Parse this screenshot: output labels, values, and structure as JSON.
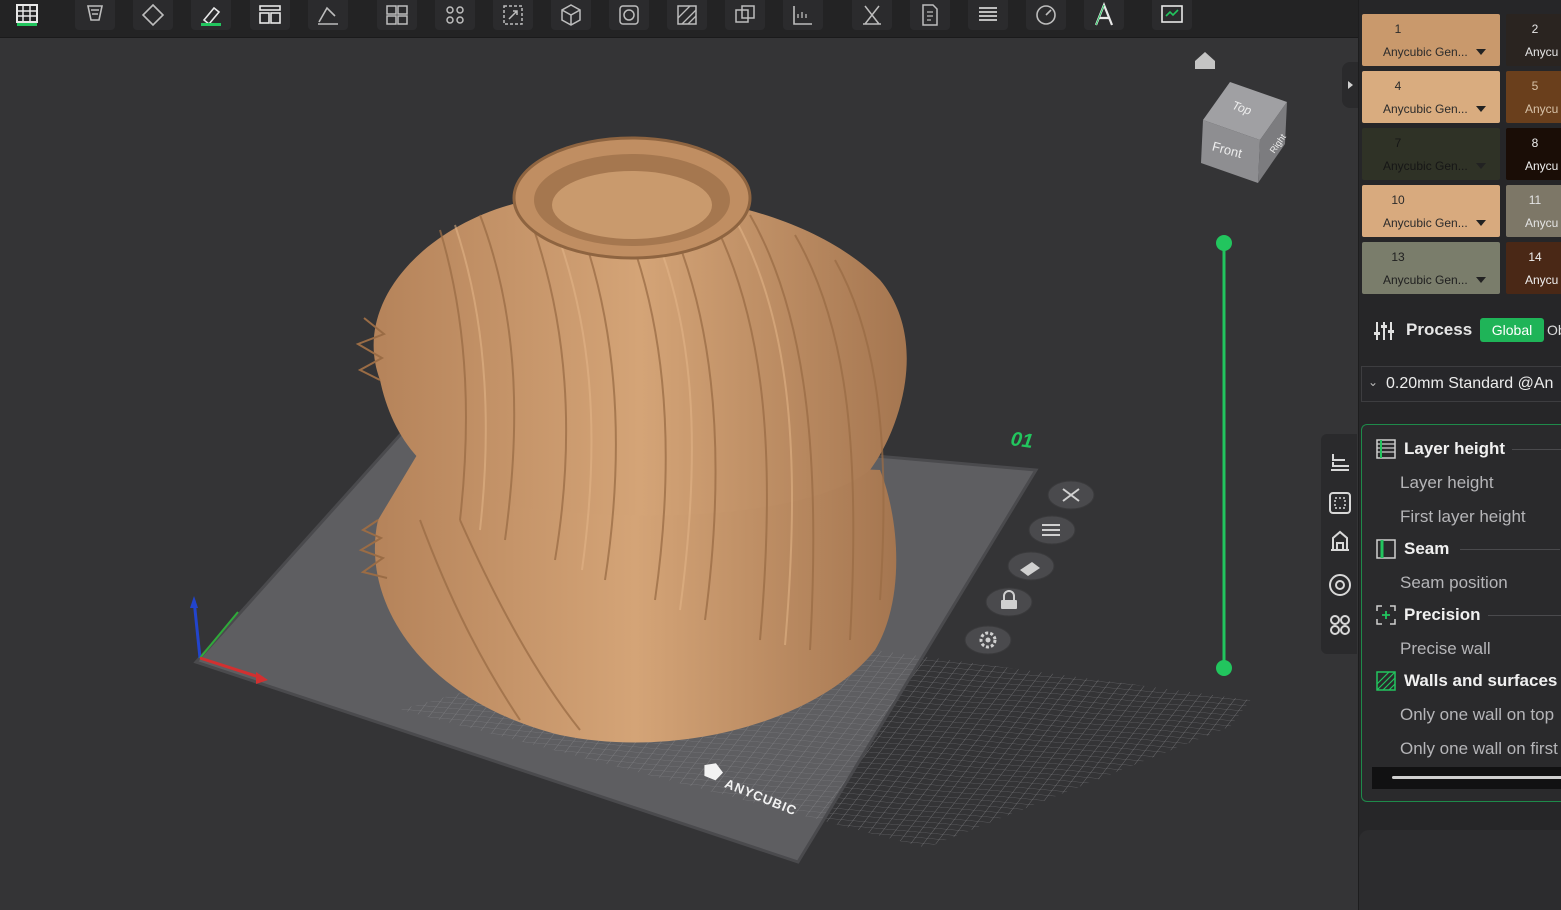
{
  "toolbar": {
    "icons": [
      "grid-icon",
      "arrange-icon",
      "orient-icon",
      "paint-icon",
      "layout-icon",
      "cut-icon",
      "split-objects-icon",
      "split-parts-icon",
      "scale-icon",
      "cube-icon",
      "hollow-icon",
      "support-icon",
      "assembly-icon",
      "measure-icon",
      "emboss-icon",
      "mesh-boolean-icon",
      "layers-icon",
      "rotate-view-icon",
      "text-tool-icon",
      "plugin-icon"
    ]
  },
  "viewport": {
    "plate_number": "01",
    "brand_text": "ANYCUBIC",
    "cube_labels": {
      "top": "Top",
      "front": "Front",
      "right": "Right"
    },
    "model_color": "#c8976b",
    "slider_color": "#22c55e"
  },
  "filaments": [
    {
      "num": "1",
      "name": "Anycubic Gen...",
      "color": "#c9996c",
      "text_color": "#2b2b2b"
    },
    {
      "num": "2",
      "name": "Anycu",
      "color": "#2a2420",
      "text_color": "#e6e6e6"
    },
    {
      "num": "4",
      "name": "Anycubic Gen...",
      "color": "#d9ac7f",
      "text_color": "#2b2b2b"
    },
    {
      "num": "5",
      "name": "Anycu",
      "color": "#6a3f1c",
      "text_color": "#d7c2a8"
    },
    {
      "num": "7",
      "name": "Anycubic Gen...",
      "color": "#2f3226",
      "text_color": "#161616"
    },
    {
      "num": "8",
      "name": "Anycu",
      "color": "#1a0d06",
      "text_color": "#efefef"
    },
    {
      "num": "10",
      "name": "Anycubic Gen...",
      "color": "#d8aa7e",
      "text_color": "#2b2b2b"
    },
    {
      "num": "11",
      "name": "Anycu",
      "color": "#7d7767",
      "text_color": "#e4e4e4"
    },
    {
      "num": "13",
      "name": "Anycubic Gen...",
      "color": "#7a7d6b",
      "text_color": "#202020"
    },
    {
      "num": "14",
      "name": "Anycu",
      "color": "#4a2816",
      "text_color": "#f0f0f0"
    }
  ],
  "process": {
    "title": "Process",
    "global_label": "Global",
    "object_label": "Ob",
    "preset": "0.20mm Standard @An"
  },
  "settings": {
    "layer_height_title": "Layer height",
    "layer_height": "Layer height",
    "first_layer_height": "First layer height",
    "seam_title": "Seam",
    "seam_position": "Seam position",
    "precision_title": "Precision",
    "precise_wall": "Precise wall",
    "walls_title": "Walls and surfaces",
    "one_wall_top": "Only one wall on top",
    "one_wall_first": "Only one wall on first"
  }
}
